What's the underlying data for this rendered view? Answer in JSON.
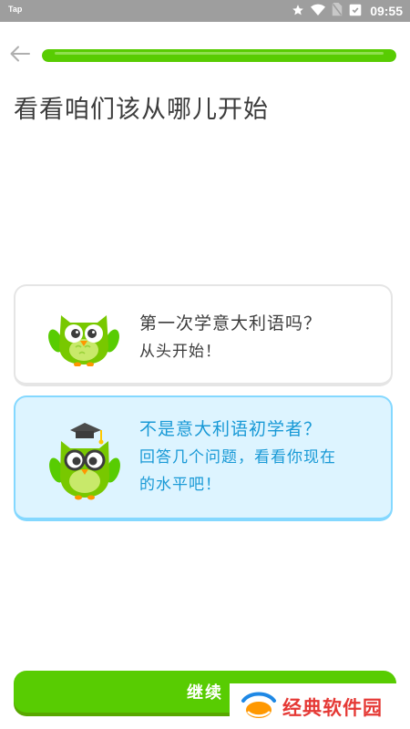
{
  "status_bar": {
    "app_label": "Tap",
    "time": "09:55"
  },
  "header": {
    "back_icon": "arrow-left-icon",
    "progress_fraction": 1.0,
    "title": "看看咱们该从哪儿开始"
  },
  "options": [
    {
      "heading": "第一次学意大利语吗？",
      "subtext_lines": [
        "从头开始！"
      ],
      "selected": false,
      "icon": "owl-mascot-icon"
    },
    {
      "heading": "不是意大利语初学者？",
      "subtext_lines": [
        "回答几个问题，看看你现在",
        "的水平吧！"
      ],
      "selected": true,
      "icon": "owl-graduate-icon"
    }
  ],
  "footer": {
    "continue_label": "继续"
  },
  "watermark": {
    "text": "经典软件园"
  },
  "colors": {
    "brand_green": "#58cc02",
    "selected_blue": "#1899d6",
    "selected_bg": "#ddf4ff",
    "watermark_red": "#e53935"
  }
}
